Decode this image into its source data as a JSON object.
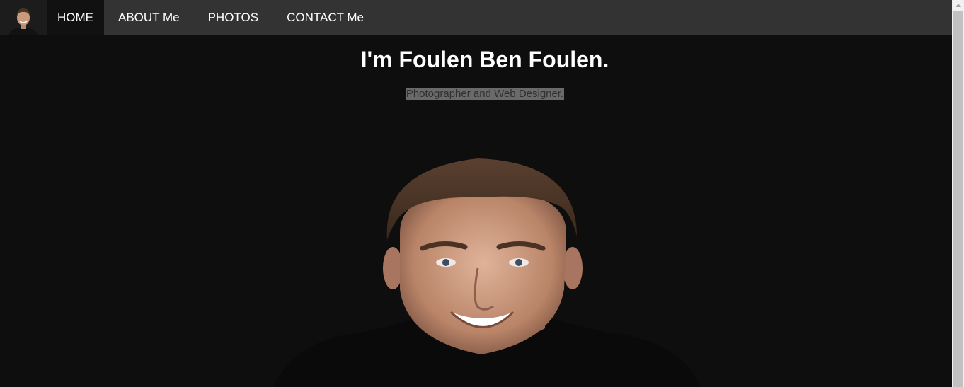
{
  "nav": {
    "logo_icon": "profile-avatar-icon",
    "items": [
      {
        "label": "HOME",
        "active": true
      },
      {
        "label": "ABOUT Me",
        "active": false
      },
      {
        "label": "PHOTOS",
        "active": false
      },
      {
        "label": "CONTACT Me",
        "active": false
      }
    ]
  },
  "hero": {
    "title": "I'm Foulen Ben Foulen.",
    "subtitle": "Photographer and Web Designer."
  },
  "colors": {
    "page_background": "#0e0e0e",
    "navbar_background": "#333333",
    "active_nav_background": "#111111",
    "subtitle_highlight": "#6a6a6a"
  }
}
